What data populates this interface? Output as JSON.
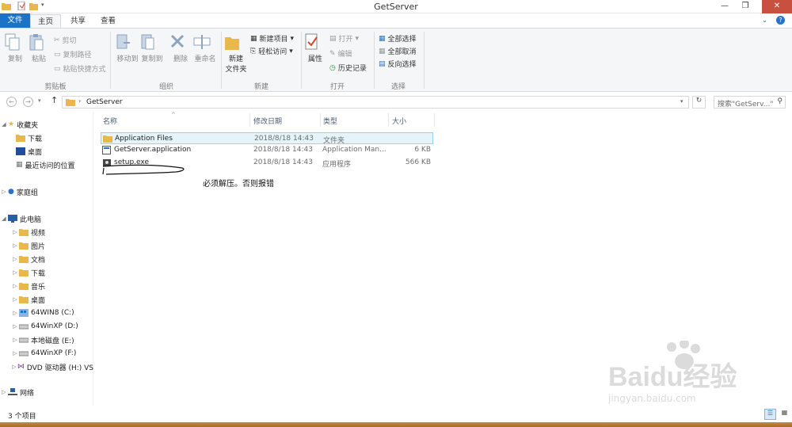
{
  "window": {
    "title": "GetServer"
  },
  "tabs": [
    {
      "label": "文件"
    },
    {
      "label": "主页"
    },
    {
      "label": "共享"
    },
    {
      "label": "查看"
    }
  ],
  "ribbon": {
    "clipboard": {
      "copy": "复制",
      "paste": "粘贴",
      "cut": "剪切",
      "copy_path": "复制路径",
      "paste_shortcut": "粘贴快捷方式",
      "group": "剪贴板"
    },
    "organize": {
      "move_to": "移动到",
      "copy_to": "复制到",
      "delete": "删除",
      "rename": "重命名",
      "group": "组织"
    },
    "new": {
      "new_folder": "新建\n文件夹",
      "new_item": "新建项目",
      "easy_access": "轻松访问",
      "group": "新建"
    },
    "open": {
      "properties": "属性",
      "open": "打开",
      "edit": "编辑",
      "history": "历史记录",
      "group": "打开"
    },
    "select": {
      "select_all": "全部选择",
      "select_none": "全部取消",
      "invert": "反向选择",
      "group": "选择"
    }
  },
  "address": {
    "path": "GetServer",
    "search_placeholder": "搜索\"GetServ...\""
  },
  "nav": {
    "favorites": "收藏夹",
    "downloads": "下载",
    "desktop": "桌面",
    "recent": "最近访问的位置",
    "homegroup": "家庭组",
    "thispc": "此电脑",
    "pc_items": [
      "视频",
      "图片",
      "文档",
      "下载",
      "音乐",
      "桌面"
    ],
    "drives": [
      "64WIN8 (C:)",
      "64WinXP  (D:)",
      "本地磁盘 (E:)",
      "64WinXP  (F:)",
      "DVD 驱动器 (H:) VS"
    ],
    "network": "网络"
  },
  "columns": {
    "name": "名称",
    "date": "修改日期",
    "type": "类型",
    "size": "大小"
  },
  "files": [
    {
      "name": "Application Files",
      "date": "2018/8/18 14:43",
      "type": "文件夹",
      "size": ""
    },
    {
      "name": "GetServer.application",
      "date": "2018/8/18 14:43",
      "type": "Application Man...",
      "size": "6 KB"
    },
    {
      "name": "setup.exe",
      "date": "2018/8/18 14:43",
      "type": "应用程序",
      "size": "566 KB"
    }
  ],
  "annotation": "必须解压。否则报错",
  "status": {
    "count": "3 个项目"
  },
  "watermark": {
    "brand": "Baidu经验",
    "url": "jingyan.baidu.com"
  },
  "colors": {
    "file_tab": "#1a73c6",
    "close": "#c7503f",
    "folder": "#e8b84a",
    "selection": "#cce8ff"
  }
}
